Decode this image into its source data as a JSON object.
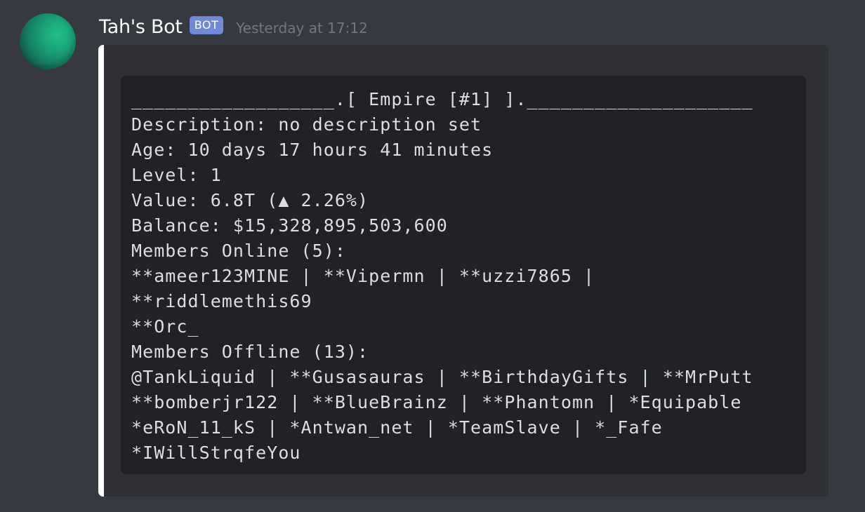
{
  "message": {
    "author": "Tah's Bot",
    "badge": "BOT",
    "timestamp": "Yesterday at 17:12",
    "avatar": "avatar-image",
    "embed": {
      "accent_color": "#ffffff",
      "code_lines": [
        "__________________.[ Empire [#1] ].____________________",
        "Description: no description set",
        "Age: 10 days 17 hours 41 minutes",
        "Level: 1",
        "Value: 6.8T (▲ 2.26%)",
        "Balance: $15,328,895,503,600",
        "Members Online (5):",
        "**ameer123MINE | **Vipermn | **uzzi7865 |",
        "**riddlemethis69",
        "**Orc_",
        "Members Offline (13):",
        "@TankLiquid | **Gusasauras | **BirthdayGifts | **MrPutt",
        "**bomberjr122 | **BlueBrainz | **Phantomn | *Equipable",
        "*eRoN_11_kS | *Antwan_net | *TeamSlave | *_Fafe",
        "*IWillStrqfeYou"
      ]
    }
  },
  "colors": {
    "background": "#36393f",
    "embed_background": "#2f3136",
    "code_background": "#202225",
    "bot_badge": "#7289da",
    "timestamp": "#72767d",
    "text": "#dcddde"
  }
}
